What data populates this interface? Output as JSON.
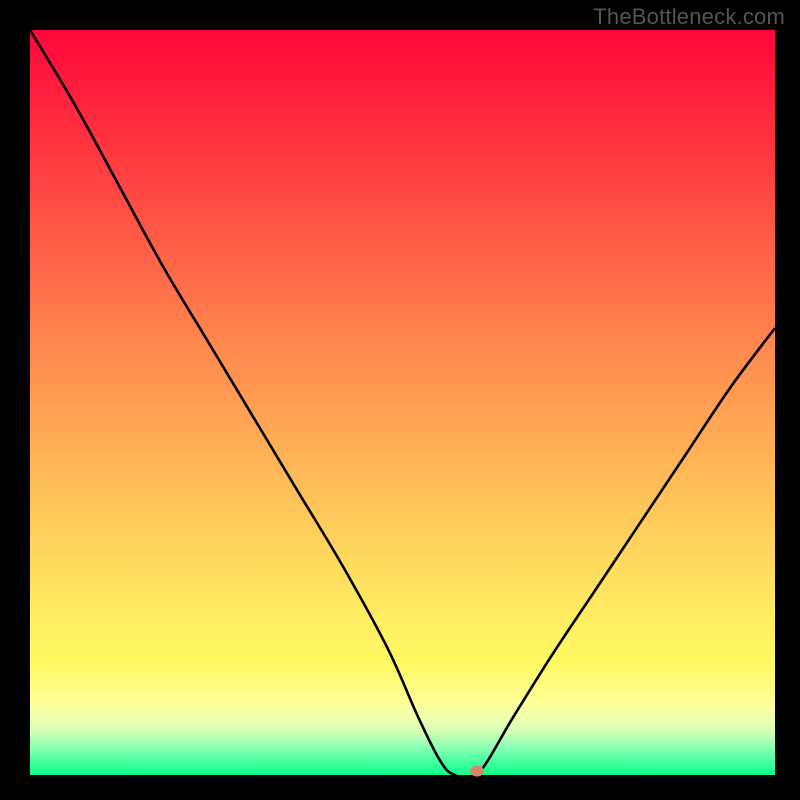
{
  "watermark": {
    "text": "TheBottleneck.com"
  },
  "chart_data": {
    "type": "line",
    "title": "",
    "xlabel": "",
    "ylabel": "",
    "xlim": [
      0,
      100
    ],
    "ylim": [
      0,
      100
    ],
    "series": [
      {
        "name": "bottleneck-curve",
        "x": [
          0,
          6,
          12,
          18,
          24,
          30,
          36,
          42,
          48,
          52,
          55,
          57,
          60,
          65,
          70,
          76,
          82,
          88,
          94,
          100
        ],
        "values": [
          100,
          90,
          79,
          68,
          58,
          48,
          38,
          28,
          17,
          8,
          2,
          0,
          0,
          8,
          16,
          25,
          34,
          43,
          52,
          60
        ]
      }
    ],
    "marker": {
      "x": 60,
      "y": 0,
      "name": "optimal-point"
    },
    "background_gradient": {
      "type": "vertical",
      "stops": [
        {
          "pos": 0,
          "color": "#ff063a"
        },
        {
          "pos": 50,
          "color": "#ff9e52"
        },
        {
          "pos": 80,
          "color": "#fff062"
        },
        {
          "pos": 100,
          "color": "#0dff8c"
        }
      ]
    }
  }
}
